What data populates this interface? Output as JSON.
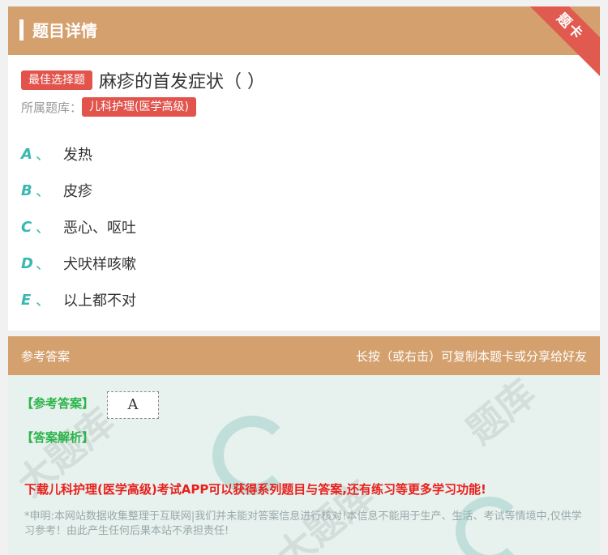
{
  "header": {
    "title": "题目详情",
    "ribbon": "题卡"
  },
  "question": {
    "type_tag": "最佳选择题",
    "text": "麻疹的首发症状（ ）"
  },
  "bank": {
    "label": "所属题库：",
    "name": "儿科护理(医学高级)"
  },
  "options": [
    {
      "letter": "A",
      "sep": "、",
      "text": "发热"
    },
    {
      "letter": "B",
      "sep": "、",
      "text": "皮疹"
    },
    {
      "letter": "C",
      "sep": "、",
      "text": "恶心、呕吐"
    },
    {
      "letter": "D",
      "sep": "、",
      "text": "犬吠样咳嗽"
    },
    {
      "letter": "E",
      "sep": "、",
      "text": "以上都不对"
    }
  ],
  "answer_section": {
    "title": "参考答案",
    "hint": "长按（或右击）可复制本题卡或分享给好友",
    "answer_label": "【参考答案】",
    "answer_value": "A",
    "analysis_label": "【答案解析】",
    "download_text": "下载儿科护理(医学高级)考试APP可以获得系列题目与答案,还有练习等更多学习功能!",
    "disclaimer": "*申明:本网站数据收集整理于互联网|我们并未能对答案信息进行核对!本信息不能用于生产、生活、考试等情境中,仅供学习参考！由此产生任何后果本站不承担责任!"
  },
  "colors": {
    "header_bg": "#d4a06e",
    "tag_bg": "#e2534c",
    "option_letter": "#38b8b0",
    "answer_green": "#2cb44a",
    "download_red": "#e8201c"
  }
}
